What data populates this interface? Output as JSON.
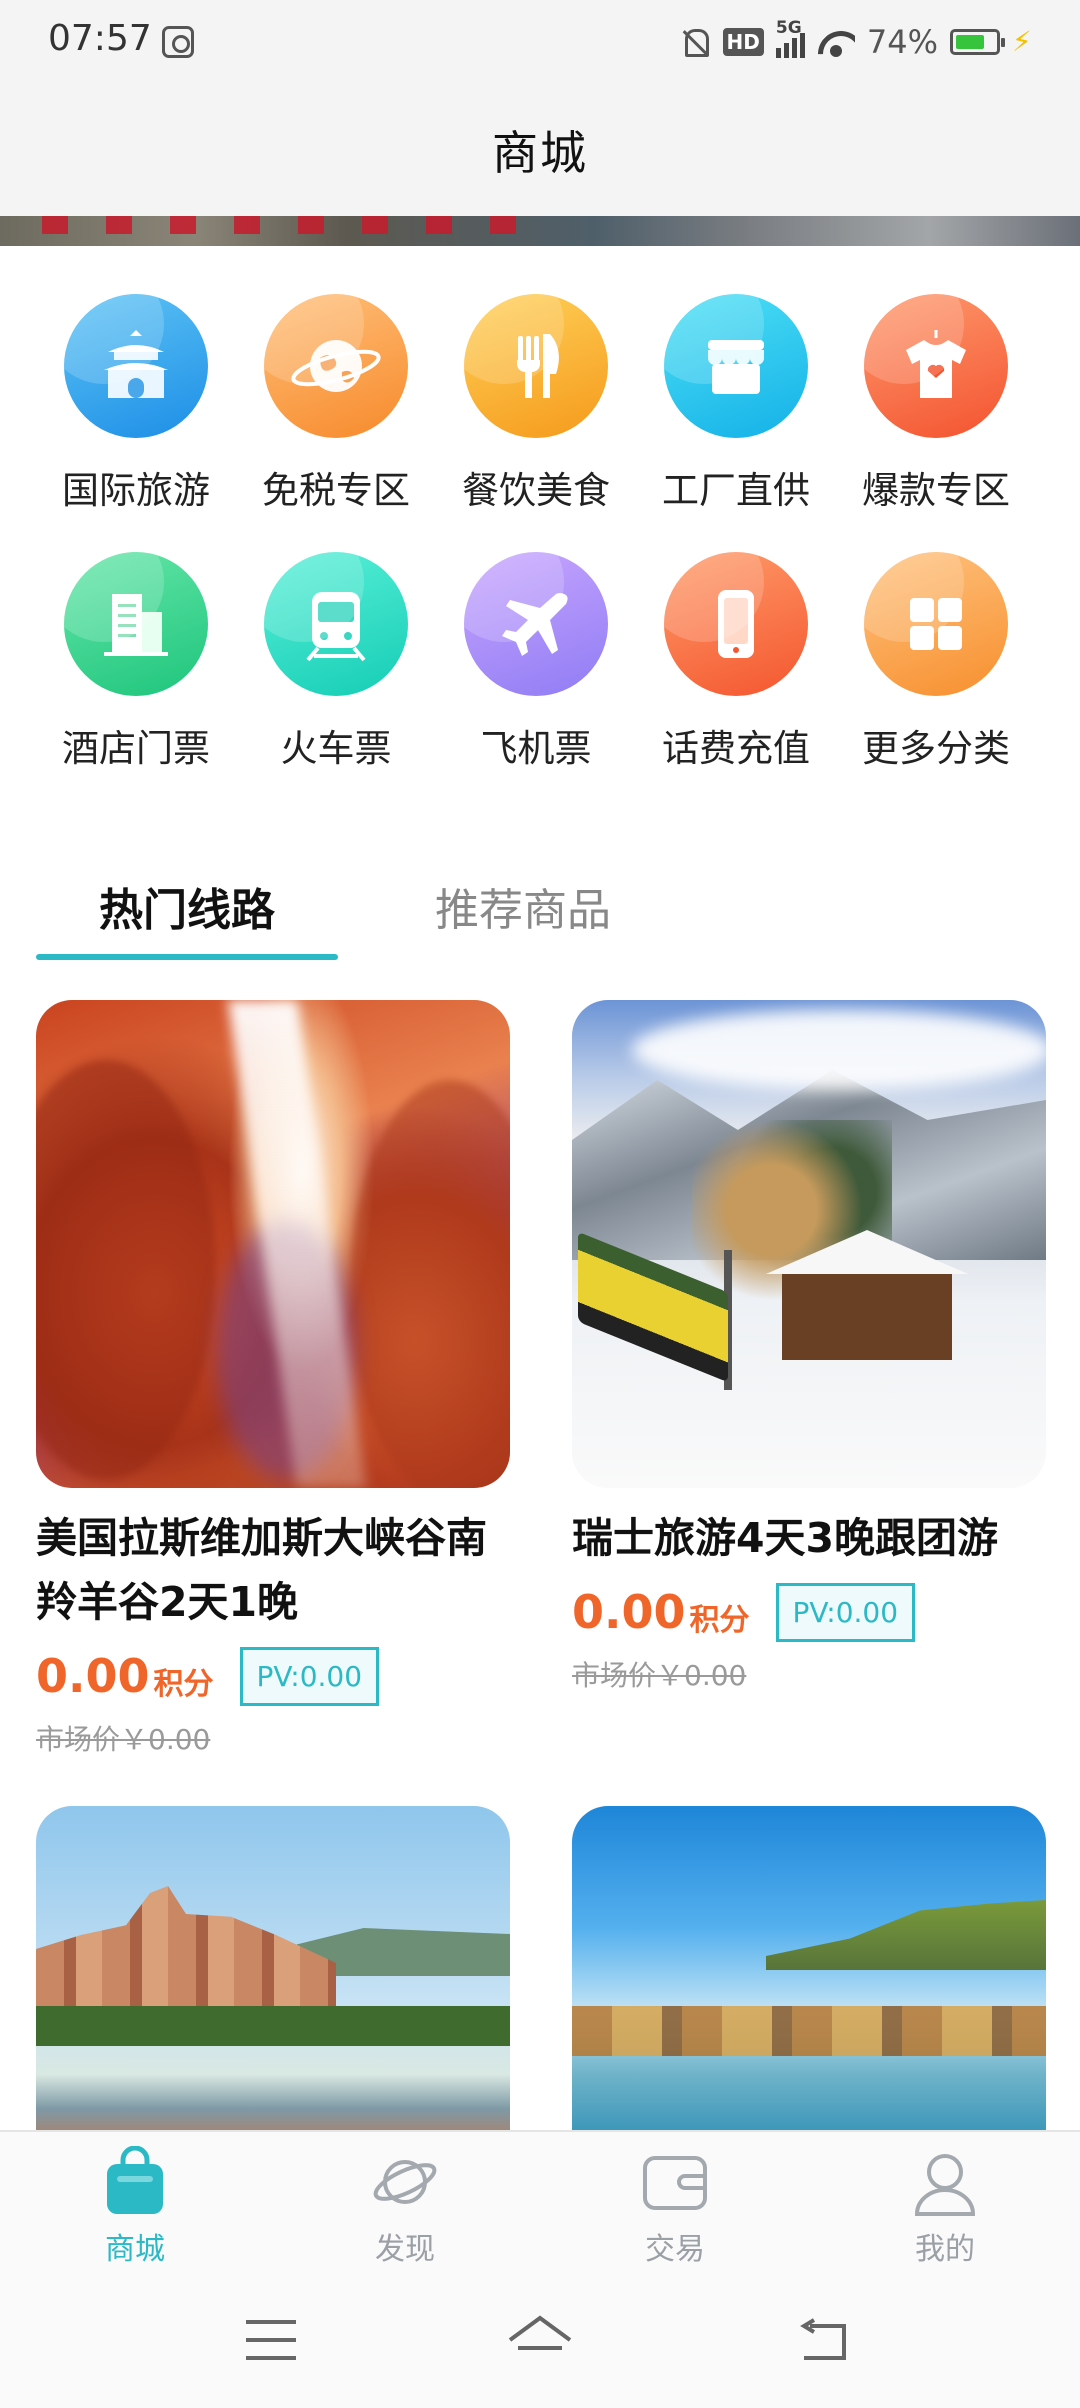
{
  "status_bar": {
    "time": "07:57",
    "hd_label": "HD",
    "network": "5G",
    "battery_percent": "74%",
    "battery_level": 0.74
  },
  "header": {
    "title": "商城"
  },
  "categories": [
    {
      "label": "国际旅游",
      "icon": "temple-icon",
      "color_from": "#5ec4f5",
      "color_to": "#1d8ee6"
    },
    {
      "label": "免税专区",
      "icon": "globe-icon",
      "color_from": "#ffc07a",
      "color_to": "#f78a2c"
    },
    {
      "label": "餐饮美食",
      "icon": "cutlery-icon",
      "color_from": "#ffd15a",
      "color_to": "#f59a1b"
    },
    {
      "label": "工厂直供",
      "icon": "store-icon",
      "color_from": "#4ee0f5",
      "color_to": "#14b1e8"
    },
    {
      "label": "爆款专区",
      "icon": "tshirt-icon",
      "color_from": "#ff9a6e",
      "color_to": "#f3532f"
    },
    {
      "label": "酒店门票",
      "icon": "hotel-icon",
      "color_from": "#66e6a9",
      "color_to": "#1ec57c"
    },
    {
      "label": "火车票",
      "icon": "train-icon",
      "color_from": "#5af0d8",
      "color_to": "#15cdb5"
    },
    {
      "label": "飞机票",
      "icon": "plane-icon",
      "color_from": "#c9a6ff",
      "color_to": "#8f7cf4"
    },
    {
      "label": "话费充值",
      "icon": "phone-icon",
      "color_from": "#ff9c6a",
      "color_to": "#f4562f"
    },
    {
      "label": "更多分类",
      "icon": "grid-icon",
      "color_from": "#ffc380",
      "color_to": "#f78f2e"
    }
  ],
  "tabs": [
    {
      "label": "热门线路",
      "active": true
    },
    {
      "label": "推荐商品",
      "active": false
    }
  ],
  "products": [
    {
      "title": "美国拉斯维加斯大峡谷南羚羊谷2天1晚",
      "price": "0.00",
      "price_unit": "积分",
      "pv": "PV:0.00",
      "market_price": "市场价￥0.00",
      "photo": "canyon"
    },
    {
      "title": "瑞士旅游4天3晚跟团游",
      "price": "0.00",
      "price_unit": "积分",
      "pv": "PV:0.00",
      "market_price": "市场价￥0.00",
      "photo": "swiss"
    },
    {
      "title": "",
      "photo": "village"
    },
    {
      "title": "",
      "photo": "sea"
    }
  ],
  "bottom_nav": [
    {
      "label": "商城",
      "icon": "bag-icon",
      "active": true
    },
    {
      "label": "发现",
      "icon": "planet-icon",
      "active": false
    },
    {
      "label": "交易",
      "icon": "wallet-icon",
      "active": false
    },
    {
      "label": "我的",
      "icon": "user-icon",
      "active": false
    }
  ],
  "colors": {
    "accent": "#2cb9c6",
    "price": "#f0662a",
    "inactive_text": "#9aa0a6"
  }
}
